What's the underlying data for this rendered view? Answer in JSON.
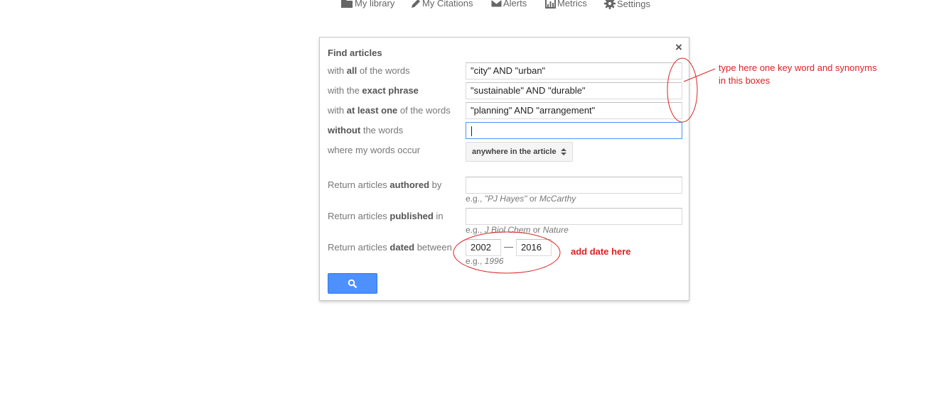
{
  "topnav": {
    "items": [
      {
        "label": "My library",
        "icon": "folder-icon"
      },
      {
        "label": "My Citations",
        "icon": "pencil-icon"
      },
      {
        "label": "Alerts",
        "icon": "envelope-icon"
      },
      {
        "label": "Metrics",
        "icon": "bar-chart-icon"
      },
      {
        "label": "Settings",
        "icon": "gear-icon"
      }
    ]
  },
  "dialog": {
    "title": "Find articles",
    "close_label": "×",
    "rows": {
      "all_words": {
        "pre": "with ",
        "bold": "all",
        "post": " of the words",
        "value": "\"city\" AND \"urban\""
      },
      "exact_phrase": {
        "pre": "with the ",
        "bold": "exact phrase",
        "post": "",
        "value": "\"sustainable\" AND \"durable\""
      },
      "at_least_one": {
        "pre": "with ",
        "bold": "at least one",
        "post": " of the words",
        "value": "\"planning\" AND \"arrangement\""
      },
      "without": {
        "pre": "",
        "bold": "without",
        "post": " the words",
        "value": ""
      },
      "occur": {
        "label": "where my words occur",
        "selected": "anywhere in the article"
      },
      "author": {
        "pre": "Return articles ",
        "bold": "authored",
        "post": " by",
        "value": "",
        "hint_pre": "e.g., ",
        "hint_i1": "\"PJ Hayes\"",
        "hint_mid": " or ",
        "hint_i2": "McCarthy"
      },
      "published": {
        "pre": "Return articles ",
        "bold": "published",
        "post": " in",
        "value": "",
        "hint_pre": "e.g., ",
        "hint_i1": "J Biol Chem",
        "hint_mid": " or ",
        "hint_i2": "Nature"
      },
      "dated": {
        "pre": "Return articles ",
        "bold": "dated",
        "post": " between",
        "from": "2002",
        "dash": "—",
        "to": "2016",
        "hint_pre": "e.g., ",
        "hint_i1": "1996"
      }
    },
    "search_icon": "search-icon"
  },
  "annotations": {
    "keyword_note_line1": "type here one key word and synonyms",
    "keyword_note_line2": "in this boxes",
    "date_note": "add date here",
    "color": "#d22222"
  },
  "colors": {
    "accent": "#4d90fe",
    "focus_border": "#4d90fe",
    "annotation": "#d22222"
  }
}
